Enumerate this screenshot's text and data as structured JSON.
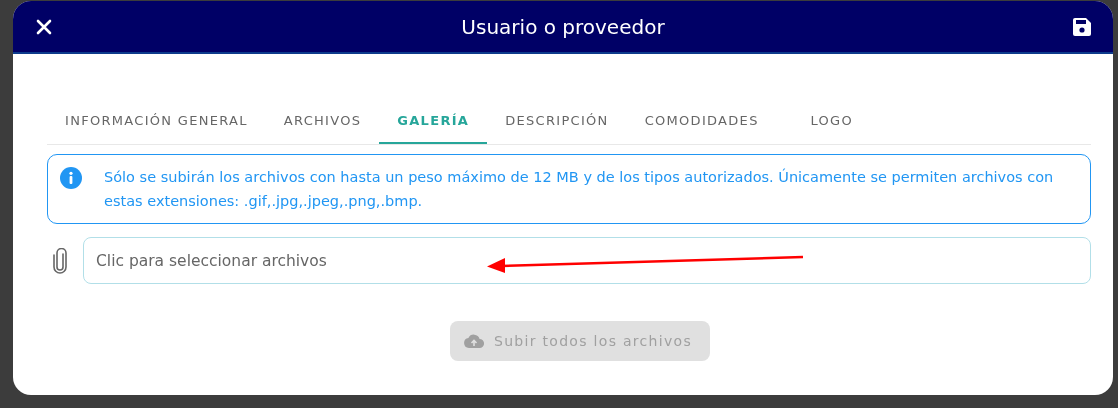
{
  "dialog": {
    "title": "Usuario o proveedor"
  },
  "tabs": [
    {
      "label": "INFORMACIÓN GENERAL",
      "selected": false
    },
    {
      "label": "ARCHIVOS",
      "selected": false
    },
    {
      "label": "GALERÍA",
      "selected": true
    },
    {
      "label": "DESCRIPCIÓN",
      "selected": false
    },
    {
      "label": "COMODIDADES",
      "selected": false
    },
    {
      "label": "LOGO",
      "selected": false
    }
  ],
  "notice": {
    "text": "Sólo se subirán los archivos con hasta un peso máximo de 12 MB y de los tipos autorizados. Únicamente se permiten archivos con estas extensiones: .gif,.jpg,.jpeg,.png,.bmp."
  },
  "file_field": {
    "placeholder": "Clic para seleccionar archivos"
  },
  "upload_button": {
    "label": "Subir todos los archivos",
    "disabled": true
  }
}
